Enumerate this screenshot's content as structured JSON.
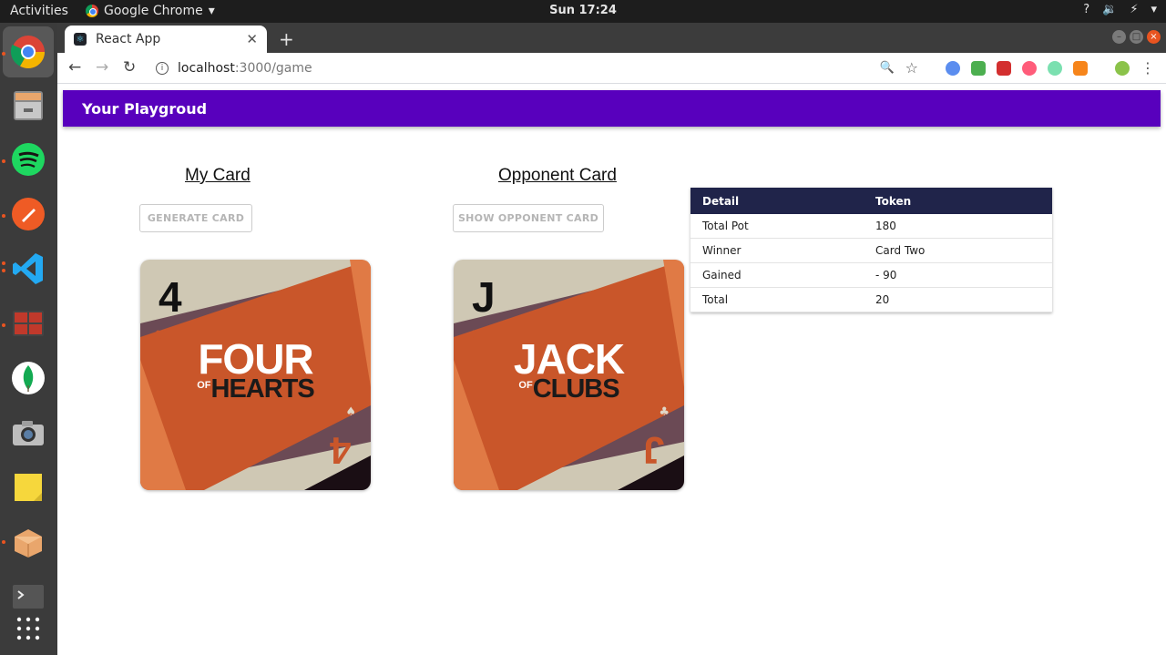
{
  "topbar": {
    "activities": "Activities",
    "app_name": "Google Chrome",
    "clock": "Sun 17:24",
    "tray": [
      "?",
      "🔉",
      "⚡",
      "▾"
    ]
  },
  "dock": {
    "items": [
      "chrome",
      "files",
      "spotify",
      "postman",
      "vscode",
      "terminal-multiplexer",
      "mongodb-compass",
      "screenshot",
      "sticky-notes",
      "app-store",
      "terminal",
      "show-apps"
    ]
  },
  "browser": {
    "tab_title": "React App",
    "tab_close": "✕",
    "new_tab": "+",
    "url_host": "localhost",
    "url_path": ":3000/game",
    "back": "←",
    "forward": "→",
    "reload": "↻",
    "zoom": "🔍",
    "star": "☆",
    "menu": "⋮"
  },
  "app": {
    "title": "Your Playgroud"
  },
  "my_card": {
    "title": "My Card",
    "button": "GENERATE CARD",
    "rank": "4",
    "name": "FOUR",
    "of": "OF",
    "suit": "HEARTS",
    "pip": "♥",
    "pip_alt": "♠"
  },
  "opponent_card": {
    "title": "Opponent Card",
    "button": "SHOW OPPONENT CARD",
    "rank": "J",
    "name": "JACK",
    "of": "OF",
    "suit": "CLUBS",
    "pip": "♣",
    "pip_alt": "♣"
  },
  "table": {
    "headers": [
      "Detail",
      "Token"
    ],
    "rows": [
      [
        "Total Pot",
        "180"
      ],
      [
        "Winner",
        "Card Two"
      ],
      [
        "Gained",
        "- 90"
      ],
      [
        "Total",
        "20"
      ]
    ]
  },
  "colors": {
    "appbar": "#5800bd",
    "table_header": "#20244a",
    "card_orange": "#c9562a",
    "card_light": "#cfc8b4",
    "card_purple": "#6b4a55"
  }
}
